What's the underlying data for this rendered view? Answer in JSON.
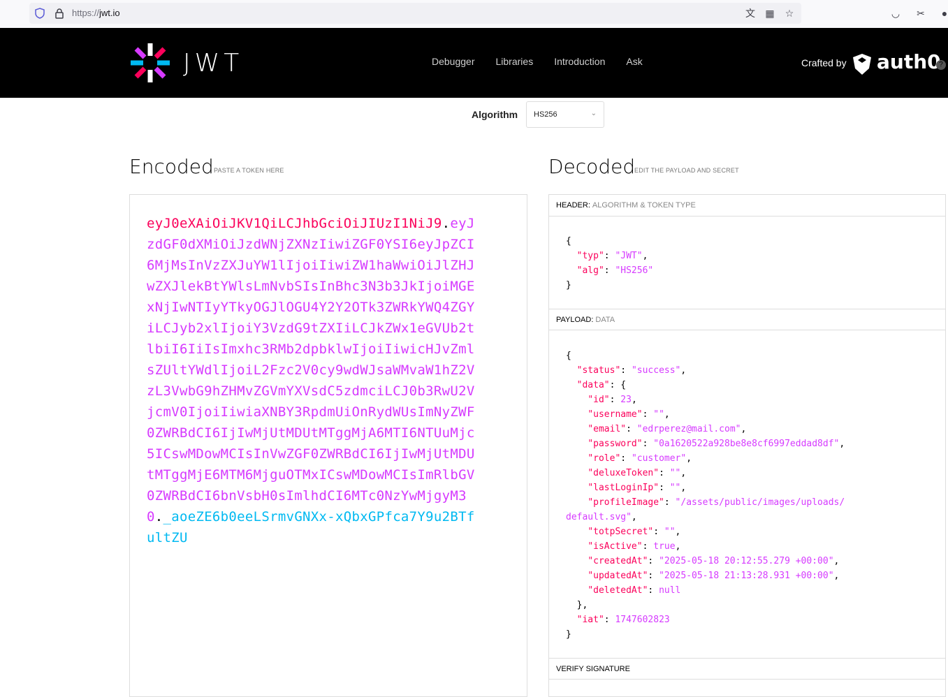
{
  "browser": {
    "url_scheme": "https://",
    "url_host": "jwt.io"
  },
  "header": {
    "logo_text": "JWT",
    "nav": [
      "Debugger",
      "Libraries",
      "Introduction",
      "Ask"
    ],
    "crafted_by": "Crafted by",
    "brand": "auth0"
  },
  "algorithm": {
    "label": "Algorithm",
    "value": "HS256"
  },
  "encoded": {
    "title": "Encoded",
    "subtitle": "PASTE A TOKEN HERE",
    "token_header": "eyJ0eXAiOiJKV1QiLCJhbGciOiJIUzI1NiJ9",
    "token_payload": "eyJzdGF0dXMiOiJzdWNjZXNzIiwiZGF0YSI6eyJpZCI6MjMsInVzZXJuYW1lIjoiIiwiZW1haWwiOiJlZHJwZXJlekBtYWlsLmNvbSIsInBhc3N3b3JkIjoiMGExNjIwNTIyYTkyOGJlOGU4Y2Y2OTk3ZWRkYWQ4ZGYiLCJyb2xlIjoiY3VzdG9tZXIiLCJkZWx1eGVUb2tlbiI6IiIsImxhc3RMb2dpbklwIjoiIiwicHJvZmlsZUltYWdlIjoiL2Fzc2V0cy9wdWJsaWMvaW1hZ2VzL3VwbG9hZHMvZGVmYXVsdC5zdmciLCJ0b3RwU2VjcmV0IjoiIiwiaXNBY3RpdmUiOnRydWUsImNyZWF0ZWRBdCI6IjIwMjUtMDUtMTggMjA6MTI6NTUuMjc5ICswMDowMCIsInVwZGF0ZWRBdCI6IjIwMjUtMDUtMTggMjE6MTM6MjguOTMxICswMDowMCIsImRlbGV0ZWRBdCI6bnVsbH0sImlhdCI6MTc0NzYwMjgyM30",
    "token_signature": "_aoeZE6b0eeLSrmvGNXx-xQbxGPfca7Y9u2BTfultZU",
    "dot": "."
  },
  "decoded": {
    "title": "Decoded",
    "subtitle": "EDIT THE PAYLOAD AND SECRET",
    "header_label": "HEADER:",
    "header_sub": "ALGORITHM & TOKEN TYPE",
    "payload_label": "PAYLOAD:",
    "payload_sub": "DATA",
    "verify_label": "VERIFY SIGNATURE",
    "header_json": {
      "typ": "\"JWT\"",
      "alg": "\"HS256\""
    },
    "payload": {
      "status": "\"success\"",
      "id": "23",
      "username": "\"\"",
      "email": "\"edrperez@mail.com\"",
      "password": "\"0a1620522a928be8e8cf6997eddad8df\"",
      "role": "\"customer\"",
      "deluxeToken": "\"\"",
      "lastLoginIp": "\"\"",
      "profileImage_1": "\"/assets/public/images/uploads/",
      "profileImage_2": "default.svg\"",
      "totpSecret": "\"\"",
      "isActive": "true",
      "createdAt": "\"2025-05-18 20:12:55.279 +00:00\"",
      "updatedAt": "\"2025-05-18 21:13:28.931 +00:00\"",
      "deletedAt": "null",
      "iat": "1747602823"
    }
  }
}
